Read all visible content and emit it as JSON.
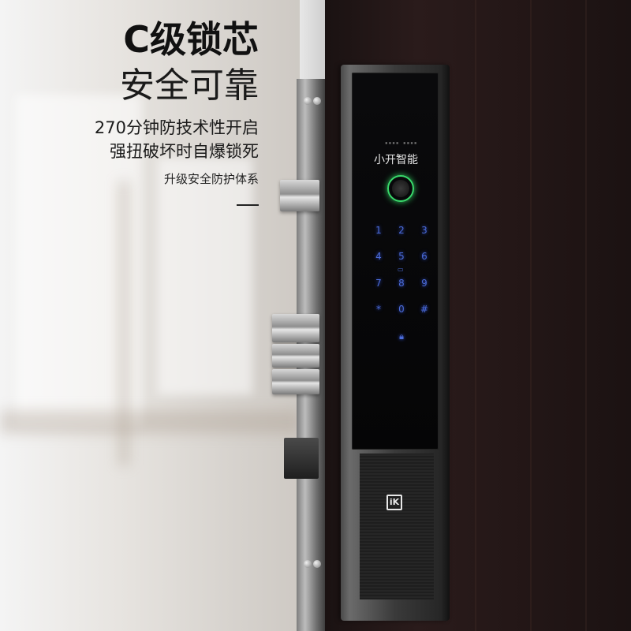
{
  "promo": {
    "headline": "C级锁芯",
    "subheadline": "安全可靠",
    "line1": "270分钟防技术性开启",
    "line2": "强扭破坏时自爆锁死",
    "line3": "升级安全防护体系"
  },
  "lock": {
    "brand_cn": "小开智能",
    "logo": "iK",
    "keypad": [
      "1",
      "2",
      "3",
      "4",
      "5",
      "6",
      "7",
      "8",
      "9",
      "*",
      "0",
      "#"
    ],
    "colors": {
      "fingerprint_ring": "#39d96b",
      "keypad_digits": "#4b6bd8",
      "door": "#241717"
    }
  }
}
